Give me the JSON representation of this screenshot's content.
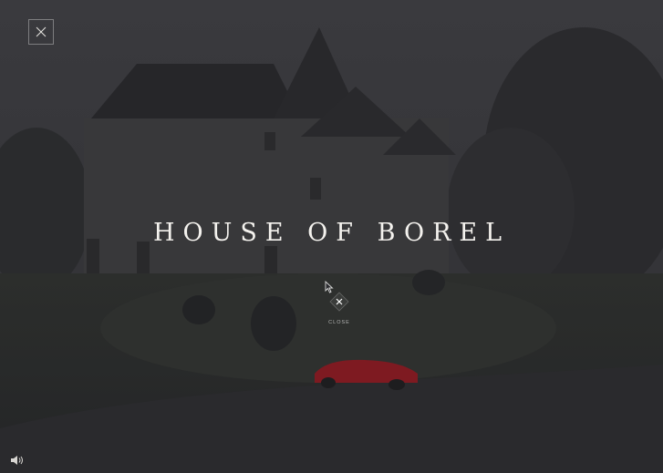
{
  "hero": {
    "title": "HOUSE OF BOREL"
  },
  "overlay": {
    "close_label": "CLOSE"
  },
  "icons": {
    "top_close": "close-icon",
    "center_close": "close-icon",
    "sound": "speaker-icon",
    "cursor": "pointer-cursor-icon"
  },
  "colors": {
    "overlay_bg": "#2b2b2f",
    "title_text": "#f4f2ee",
    "car_red": "#8f1d24"
  }
}
